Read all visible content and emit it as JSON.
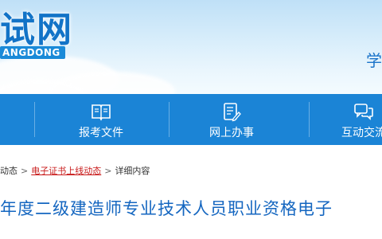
{
  "header": {
    "logo_title": "试网",
    "logo_subtitle": "ANGDONG",
    "right_text": "学"
  },
  "nav": {
    "items": [
      {
        "label": "报考文件",
        "icon": "book-icon"
      },
      {
        "label": "网上办事",
        "icon": "document-edit-icon"
      },
      {
        "label": "互动交流",
        "icon": "chat-icon"
      }
    ]
  },
  "breadcrumb": {
    "first": "动态",
    "separator": ">",
    "link": "电子证书上线动态",
    "current": "详细内容"
  },
  "article": {
    "title": "年度二级建造师专业技术人员职业资格电子"
  },
  "colors": {
    "brand_blue": "#1b84d6",
    "link_red": "#c81a1a",
    "title_blue": "#1466c0"
  }
}
